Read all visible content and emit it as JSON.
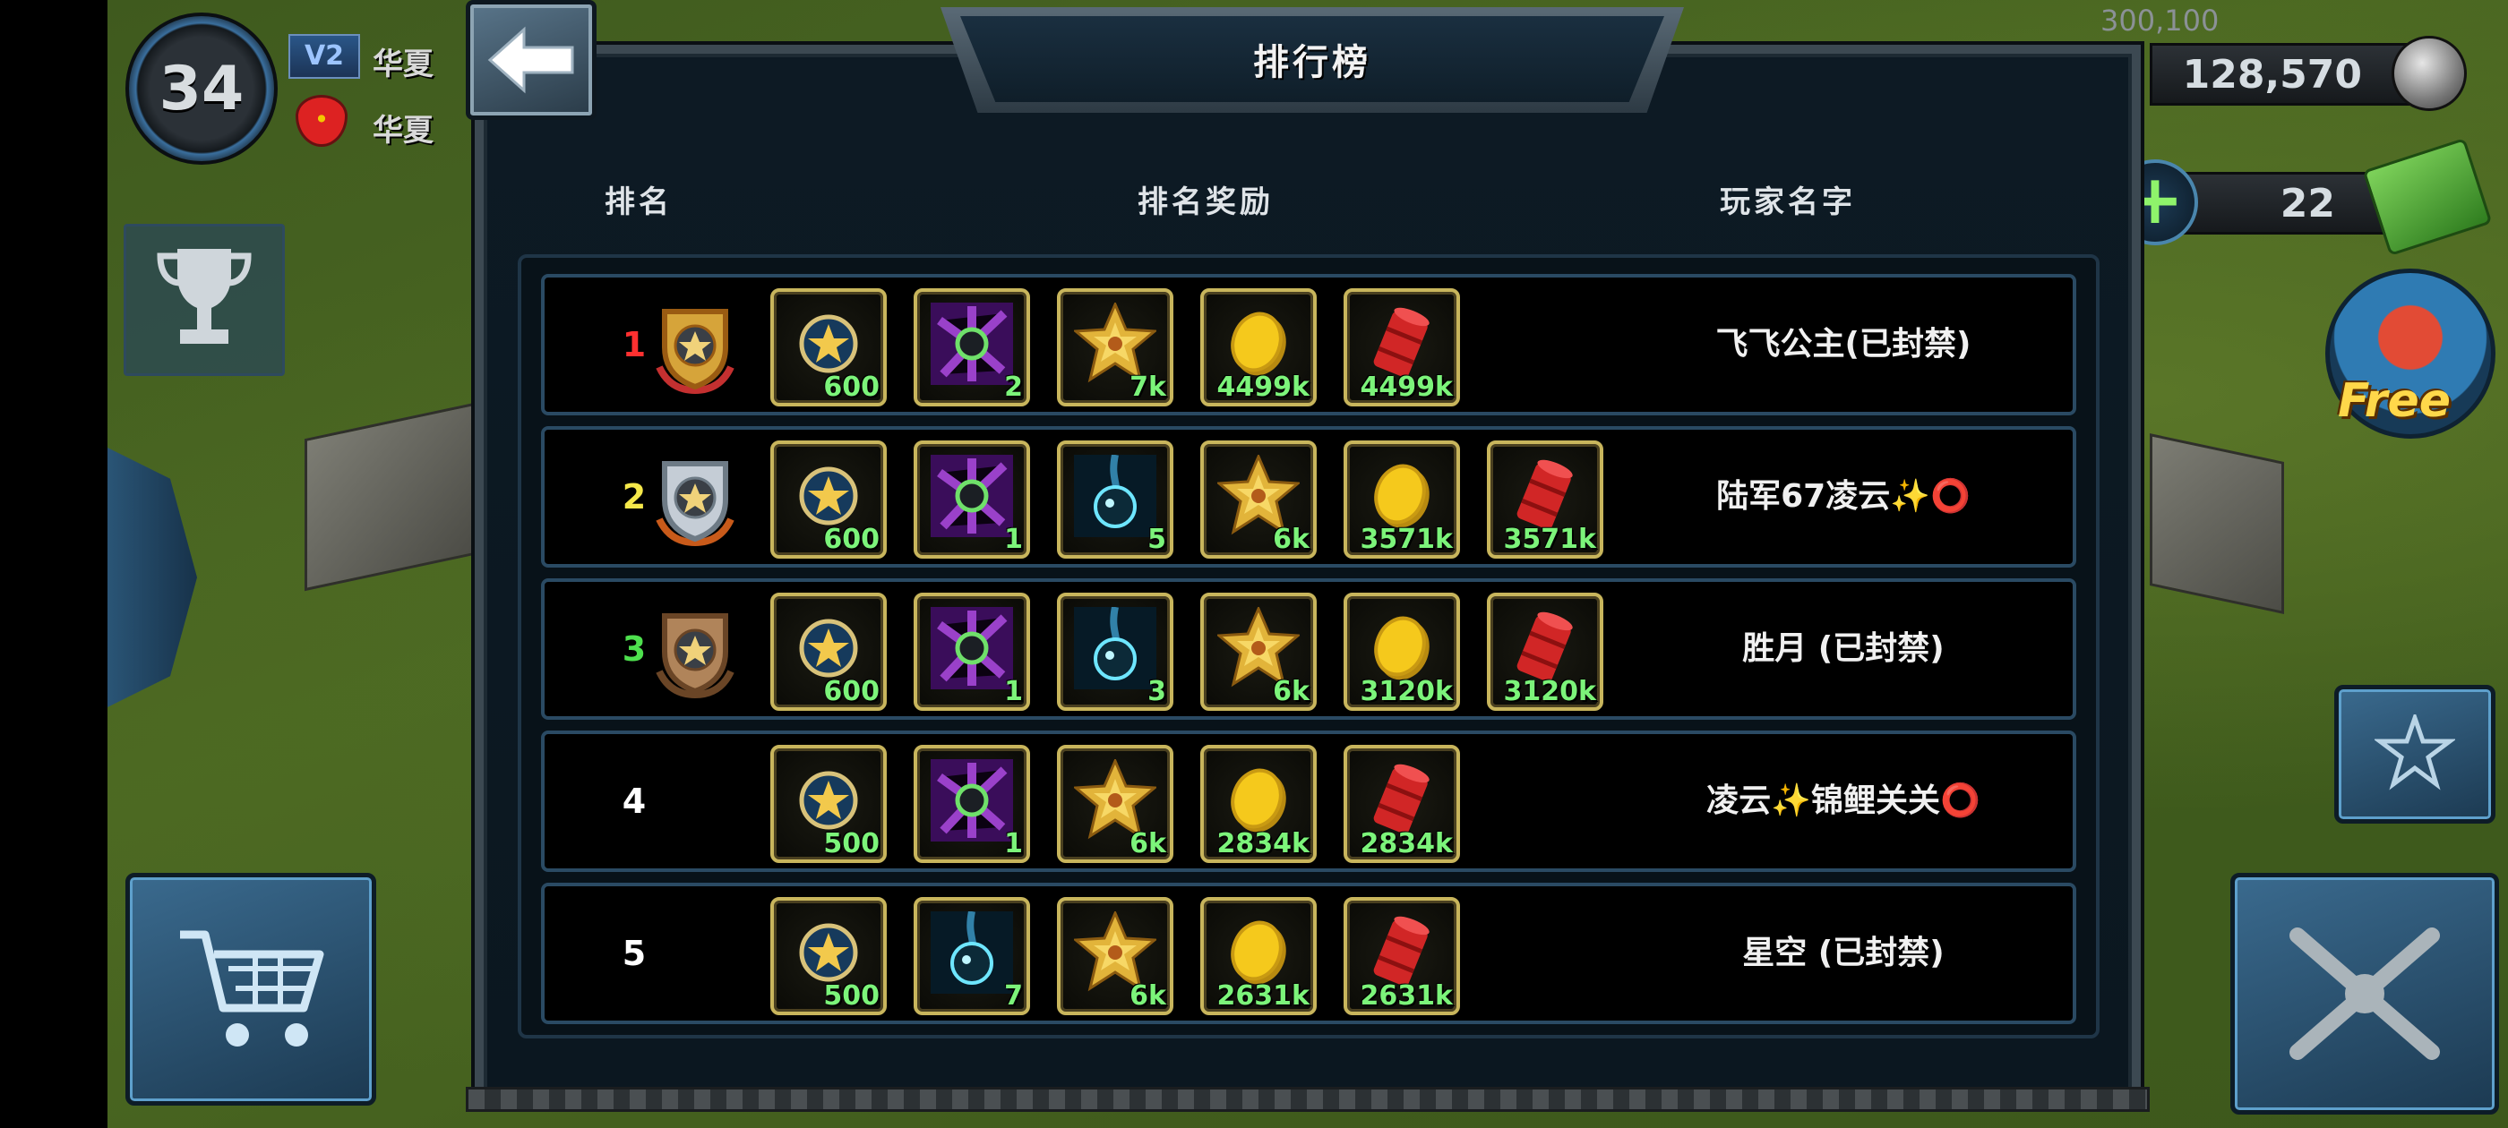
{
  "hud": {
    "level": "34",
    "vip": "V2",
    "player_name": "华夏",
    "alliance_name": "华夏",
    "free_label": "Free",
    "resources": {
      "cap": "300,100",
      "current": "128,570",
      "cash": "22"
    }
  },
  "dialog": {
    "title": "排行榜",
    "headers": {
      "rank": "排名",
      "reward": "排名奖励",
      "player": "玩家名字"
    }
  },
  "colors": {
    "rank1": "#ff3030",
    "rank2": "#f5e84a",
    "rank3": "#4ee04e",
    "rank_other": "#ffffff",
    "qty": "#7cf47a",
    "item_border": "#c8b55c"
  },
  "rankings": [
    {
      "rank": "1",
      "medal": "gold",
      "player": "飞飞公主(已封禁)",
      "rewards": [
        {
          "icon": "star-badge-icon",
          "qty": "600"
        },
        {
          "icon": "purple-crystal-icon",
          "qty": "2"
        },
        {
          "icon": "gold-star-medal-icon",
          "qty": "7k"
        },
        {
          "icon": "gold-coin-icon",
          "qty": "4499k"
        },
        {
          "icon": "fuel-barrel-icon",
          "qty": "4499k"
        }
      ]
    },
    {
      "rank": "2",
      "medal": "silver",
      "player": "陆军67凌云✨⭕",
      "rewards": [
        {
          "icon": "star-badge-icon",
          "qty": "600"
        },
        {
          "icon": "purple-crystal-icon",
          "qty": "1"
        },
        {
          "icon": "blue-orb-icon",
          "qty": "5"
        },
        {
          "icon": "gold-star-medal-icon",
          "qty": "6k"
        },
        {
          "icon": "gold-coin-icon",
          "qty": "3571k"
        },
        {
          "icon": "fuel-barrel-icon",
          "qty": "3571k"
        }
      ]
    },
    {
      "rank": "3",
      "medal": "bronze",
      "player": "胜月 (已封禁)",
      "rewards": [
        {
          "icon": "star-badge-icon",
          "qty": "600"
        },
        {
          "icon": "purple-crystal-icon",
          "qty": "1"
        },
        {
          "icon": "blue-orb-icon",
          "qty": "3"
        },
        {
          "icon": "gold-star-medal-icon",
          "qty": "6k"
        },
        {
          "icon": "gold-coin-icon",
          "qty": "3120k"
        },
        {
          "icon": "fuel-barrel-icon",
          "qty": "3120k"
        }
      ]
    },
    {
      "rank": "4",
      "medal": "",
      "player": "凌云✨锦鲤关关⭕",
      "rewards": [
        {
          "icon": "star-badge-icon",
          "qty": "500"
        },
        {
          "icon": "purple-crystal-icon",
          "qty": "1"
        },
        {
          "icon": "gold-star-medal-icon",
          "qty": "6k"
        },
        {
          "icon": "gold-coin-icon",
          "qty": "2834k"
        },
        {
          "icon": "fuel-barrel-icon",
          "qty": "2834k"
        }
      ]
    },
    {
      "rank": "5",
      "medal": "",
      "player": "星空 (已封禁)",
      "rewards": [
        {
          "icon": "star-badge-icon",
          "qty": "500"
        },
        {
          "icon": "blue-orb-icon",
          "qty": "7"
        },
        {
          "icon": "gold-star-medal-icon",
          "qty": "6k"
        },
        {
          "icon": "gold-coin-icon",
          "qty": "2631k"
        },
        {
          "icon": "fuel-barrel-icon",
          "qty": "2631k"
        }
      ]
    }
  ]
}
